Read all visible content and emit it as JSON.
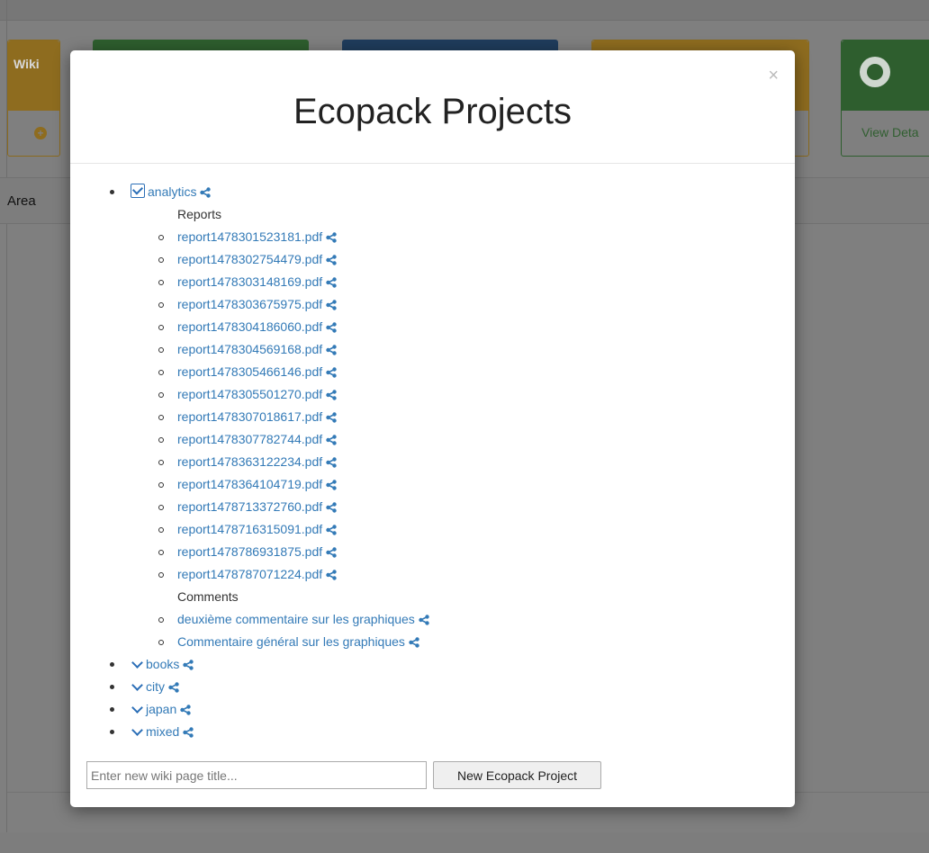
{
  "background": {
    "wiki_card_label": "Wiki",
    "detail_button_label": "View Deta",
    "area_label": "Area"
  },
  "modal": {
    "title": "Ecopack Projects",
    "close_symbol": "×",
    "projects": [
      {
        "name": "analytics",
        "expanded": true,
        "sections": [
          {
            "heading": "Reports",
            "items": [
              "report1478301523181.pdf",
              "report1478302754479.pdf",
              "report1478303148169.pdf",
              "report1478303675975.pdf",
              "report1478304186060.pdf",
              "report1478304569168.pdf",
              "report1478305466146.pdf",
              "report1478305501270.pdf",
              "report1478307018617.pdf",
              "report1478307782744.pdf",
              "report1478363122234.pdf",
              "report1478364104719.pdf",
              "report1478713372760.pdf",
              "report1478716315091.pdf",
              "report1478786931875.pdf",
              "report1478787071224.pdf"
            ]
          },
          {
            "heading": "Comments",
            "items": [
              "deuxième commentaire sur les graphiques",
              "Commentaire général sur les graphiques"
            ]
          }
        ]
      },
      {
        "name": "books",
        "expanded": false
      },
      {
        "name": "city",
        "expanded": false
      },
      {
        "name": "japan",
        "expanded": false
      },
      {
        "name": "mixed",
        "expanded": false
      }
    ],
    "new_project": {
      "placeholder": "Enter new wiki page title...",
      "value": "",
      "button_label": "New Ecopack Project"
    }
  },
  "colors": {
    "link": "#337ab7",
    "overlay": "#7f7f7f"
  },
  "icons": {
    "share": "share-alt-icon",
    "expanded": "check-square-icon",
    "collapsed": "chevron-down-icon",
    "close": "close-icon"
  }
}
